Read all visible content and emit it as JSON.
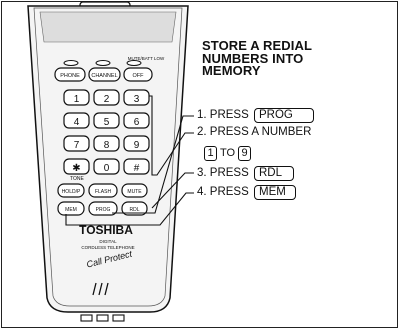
{
  "phone": {
    "status_label": "MUTE/BATT LOW",
    "top_buttons": [
      "PHONE",
      "CHANNEL",
      "OFF"
    ],
    "keypad": [
      "1",
      "2",
      "3",
      "4",
      "5",
      "6",
      "7",
      "8",
      "9",
      "✱",
      "0",
      "#"
    ],
    "tone_label": "TONE",
    "func_row1": [
      "HOLD/P",
      "FLASH",
      "MUTE"
    ],
    "func_row2": [
      "MEM",
      "PROG",
      "RDL"
    ],
    "brand": "TOSHIBA",
    "model_line1": "DIGITAL",
    "model_line2": "CORDLESS TELEPHONE",
    "script_logo": "Call Protect"
  },
  "instructions": {
    "title": "STORE A REDIAL NUMBERS INTO MEMORY",
    "step1": {
      "text": "1. PRESS",
      "key": "PROG"
    },
    "step2": {
      "text": "2. PRESS A NUMBER",
      "from": "1",
      "to_word": "TO",
      "to": "9"
    },
    "step3": {
      "text": "3. PRESS",
      "key": "RDL"
    },
    "step4": {
      "text": "4. PRESS",
      "key": "MEM"
    }
  }
}
